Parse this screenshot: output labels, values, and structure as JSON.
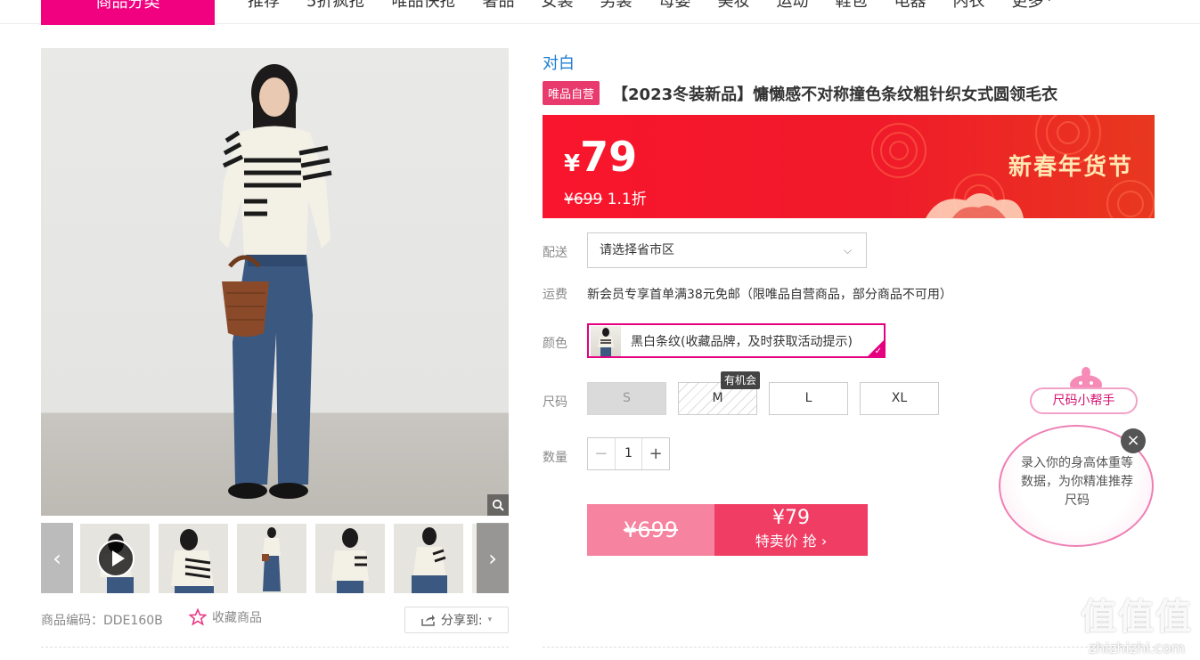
{
  "nav": {
    "category_label": "商品分类",
    "items": [
      "推荐",
      "5折疯抢",
      "唯品快抢",
      "奢品",
      "女装",
      "男装",
      "母婴",
      "美妆",
      "运动",
      "鞋包",
      "电器",
      "内衣",
      "更多"
    ]
  },
  "gallery": {
    "product_code_label": "商品编码：DDE160B",
    "favorite_label": "收藏商品",
    "share_label": "分享到:"
  },
  "product": {
    "brand": "对白",
    "tag": "唯品自营",
    "title": "【2023冬装新品】慵懒感不对称撞色条纹粗针织女式圆领毛衣"
  },
  "price": {
    "currency": "¥",
    "current": "79",
    "original": "¥699",
    "discount": "1.1折",
    "festival": "新春年货节"
  },
  "delivery": {
    "label": "配送",
    "placeholder": "请选择省市区"
  },
  "shipping": {
    "label": "运费",
    "text": "新会员专享首单满38元免邮（限唯品自营商品，部分商品不可用）"
  },
  "color": {
    "label": "颜色",
    "selected": "黑白条纹(收藏品牌，及时获取活动提示)"
  },
  "size": {
    "label": "尺码",
    "options": [
      "S",
      "M",
      "L",
      "XL"
    ],
    "tooltip": "有机会"
  },
  "quantity": {
    "label": "数量",
    "value": "1",
    "minus": "−",
    "plus": "+"
  },
  "buy": {
    "original": "¥699",
    "special_price": "¥79",
    "special_label": "特卖价 抢 ›"
  },
  "helper": {
    "button": "尺码小帮手",
    "text": "录入你的身高体重等数据，为你精准推荐尺码",
    "close": "×"
  },
  "watermark": {
    "big": "值值值",
    "small": "zhizhizhi.com"
  },
  "colors": {
    "brand_pink": "#f10180",
    "price_red": "#f9152d",
    "buy_pink": "#ef3d64",
    "brand_link": "#1e7fd3"
  }
}
